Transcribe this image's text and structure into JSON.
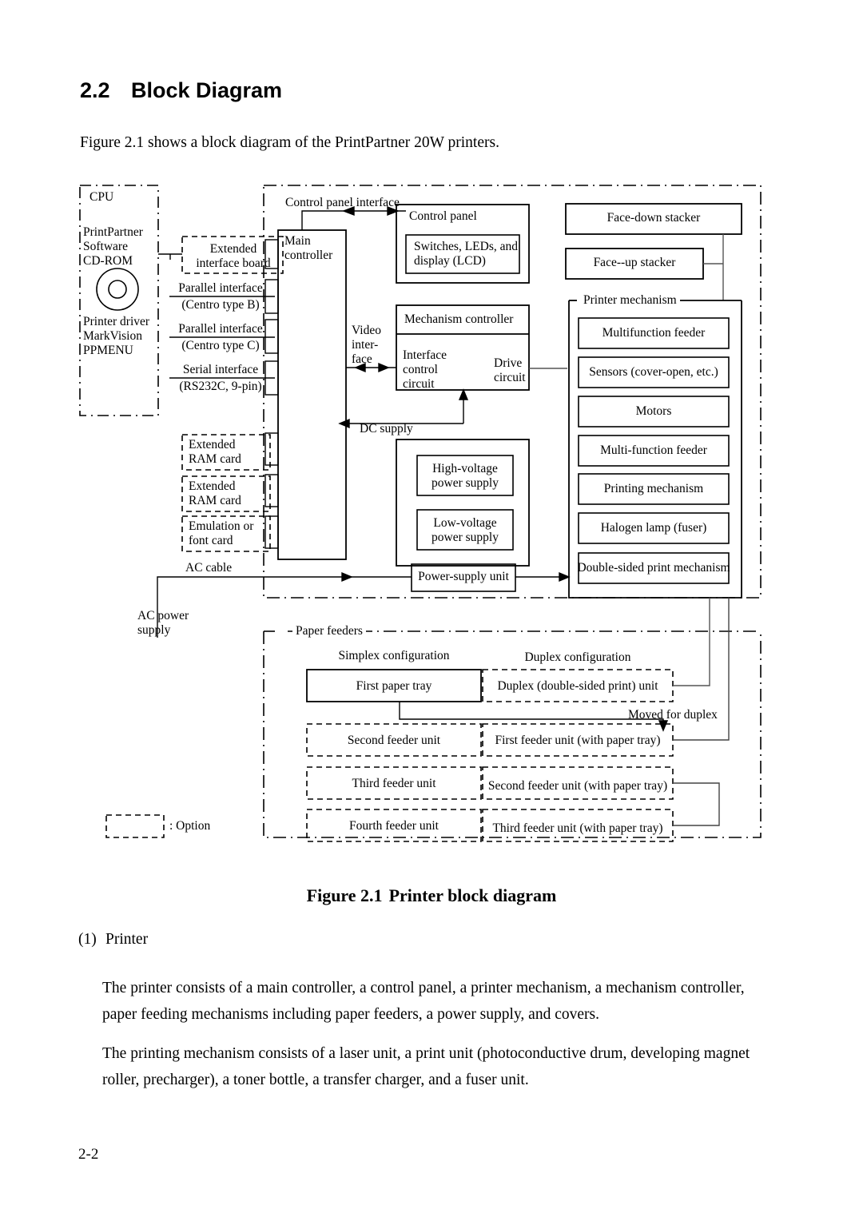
{
  "section": {
    "number": "2.2",
    "title": "Block Diagram",
    "intro": "Figure 2.1 shows a block diagram of the PrintPartner 20W printers."
  },
  "figure": {
    "caption_number": "Figure 2.1",
    "caption_title": "Printer block diagram",
    "legend": {
      "option_text": ": Option"
    },
    "cpu": {
      "title": "CPU",
      "software_lines": "PrintPartner\nSoftware\nCD-ROM",
      "driver_lines": "Printer driver\nMarkVision\nPPMENU",
      "disc_icon": "cd-rom-disc-icon"
    },
    "interfaces": [
      {
        "name": "Parallel interface",
        "spec": "(Centro type B)"
      },
      {
        "name": "Parallel interface",
        "spec": "(Centro type C)"
      },
      {
        "name": "Serial interface",
        "spec": "(RS232C, 9-pin)"
      }
    ],
    "option_cards": [
      "Extended\ninterface board",
      "Extended\nRAM card",
      "Extended\nRAM card",
      "Emulation or\nfont card"
    ],
    "controller": {
      "main": "Main\ncontroller",
      "control_panel_interface": "Control panel interface",
      "video_interface": "Video\ninter-\nface",
      "control_panel": "Control panel",
      "control_panel_inner": "Switches, LEDs, and\ndisplay (LCD)",
      "mechanism_controller": "Mechanism controller",
      "interface_control_circuit": "Interface\ncontrol\ncircuit",
      "drive_circuit": "Drive\ncircuit"
    },
    "power": {
      "dc_supply": "DC supply",
      "high_voltage": "High-voltage\npower supply",
      "low_voltage": "Low-voltage\npower supply",
      "power_supply_unit": "Power-supply unit",
      "ac_cable": "AC cable",
      "ac_power_supply": "AC power\nsupply"
    },
    "stackers": [
      "Face-down stacker",
      "Face--up stacker"
    ],
    "printer_mechanism": {
      "title": "Printer mechanism",
      "items": [
        "Multifunction feeder",
        "Sensors (cover-open, etc.)",
        "Motors",
        "Multi-function feeder",
        "Printing mechanism",
        "Halogen lamp (fuser)",
        "Double-sided print mechanism"
      ]
    },
    "paper_feeders": {
      "title": "Paper feeders",
      "column_headers": [
        "Simplex configuration",
        "Duplex configuration"
      ],
      "moved_for_duplex": "Moved for duplex",
      "rows": [
        {
          "simplex": "First paper tray",
          "duplex": "Duplex (double-sided print) unit"
        },
        {
          "simplex": "Second feeder unit",
          "duplex": "First feeder unit (with paper tray)"
        },
        {
          "simplex": "Third feeder unit",
          "duplex": "Second feeder unit (with paper tray)"
        },
        {
          "simplex": "Fourth feeder unit",
          "duplex": "Third feeder unit (with paper tray)"
        }
      ]
    }
  },
  "body": {
    "item_number": "(1)",
    "item_title": "Printer",
    "paragraph1": "The printer consists of a main controller, a control panel, a printer mechanism, a mechanism controller, paper feeding mechanisms including paper feeders, a power supply, and covers.",
    "paragraph2": "The printing mechanism consists of a laser unit, a print unit (photoconductive drum, developing magnet roller, precharger), a toner bottle, a transfer charger, and a fuser unit."
  },
  "footer": {
    "page": "2-2"
  }
}
